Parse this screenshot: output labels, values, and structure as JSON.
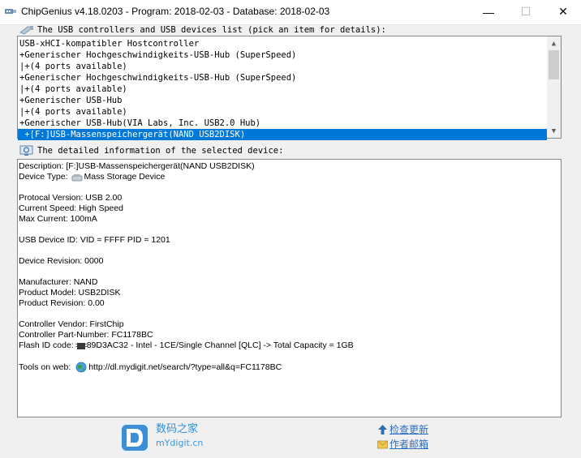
{
  "window": {
    "title": "ChipGenius v4.18.0203 - Program: 2018-02-03 - Database: 2018-02-03",
    "min_glyph": "—",
    "max_glyph": "☐",
    "close_glyph": "✕"
  },
  "device_list": {
    "label": "The USB controllers and USB devices list (pick an item for details):",
    "items": [
      "USB-xHCI-kompatibler Hostcontroller",
      "+Generischer Hochgeschwindigkeits-USB-Hub (SuperSpeed)",
      "|+(4 ports available)",
      "+Generischer Hochgeschwindigkeits-USB-Hub (SuperSpeed)",
      "|+(4 ports available)",
      "+Generischer USB-Hub",
      "|+(4 ports available)",
      "+Generischer USB-Hub(VIA Labs, Inc. USB2.0 Hub)",
      " +[F:]USB-Massenspeichergerät(NAND USB2DISK)"
    ],
    "selected_index": 8,
    "scroll_up": "▲",
    "scroll_down": "▼"
  },
  "details": {
    "label": "The detailed information of the selected device:",
    "description": "Description: [F:]USB-Massenspeichergerät(NAND USB2DISK)",
    "device_type_label": "Device Type:",
    "device_type_value": "Mass Storage Device",
    "protocol_version": "Protocal Version: USB 2.00",
    "current_speed": "Current Speed: High Speed",
    "max_current": "Max Current: 100mA",
    "usb_device_id": "USB Device ID: VID = FFFF PID = 1201",
    "device_revision": "Device Revision: 0000",
    "manufacturer": "Manufacturer: NAND",
    "product_model": "Product Model: USB2DISK",
    "product_revision": "Product Revision: 0.00",
    "controller_vendor": "Controller Vendor: FirstChip",
    "controller_part_number": "Controller Part-Number: FC1178BC",
    "flash_id_label": "Flash ID code:",
    "flash_id_value": "89D3AC32 - Intel - 1CE/Single Channel [QLC] -> Total Capacity = 1GB",
    "tools_label": "Tools on web:",
    "tools_url": "http://dl.mydigit.net/search/?type=all&q=FC1178BC"
  },
  "footer": {
    "brand_cn": "数码之家",
    "brand_en": "mYdigit.cn",
    "check_update": "检查更新",
    "author_mail": "作者邮箱"
  },
  "icons": {
    "app": "usb-icon",
    "list_label": "usb-cable-icon",
    "details_label": "info-monitor-icon",
    "device_type": "mass-storage-icon",
    "flash": "chip-icon",
    "web": "globe-icon",
    "logo": "mydigit-logo-icon",
    "update": "up-arrow-icon",
    "mail": "envelope-icon"
  },
  "colors": {
    "selection": "#0078d7",
    "brand": "#2d8fd6",
    "link": "#2d6fc0"
  }
}
